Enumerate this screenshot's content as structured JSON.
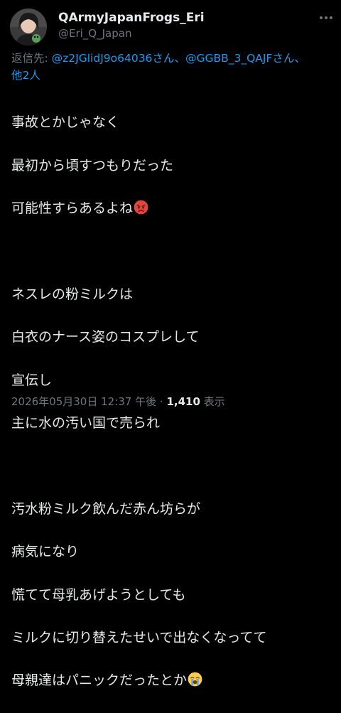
{
  "author": {
    "display_name": "QArmyJapanFrogs_Eri",
    "handle": "@Eri_Q_Japan"
  },
  "reply_to": {
    "prefix": "返信先: ",
    "mention_1": "@z2JGlidJ9o64036さん",
    "separator": "、",
    "mention_2": "@GGBB_3_QAJFさん",
    "separator_2": "、",
    "others": "他2人"
  },
  "body": {
    "line_1": "事故とかじゃなく",
    "line_2": "最初から頃すつもりだった",
    "line_3": "可能性すらあるよね",
    "line_4": "",
    "line_5": "ネスレの粉ミルクは",
    "line_6": "白衣のナース姿のコスプレして",
    "line_7": "宣伝し",
    "line_8": "主に水の汚い国で売られ",
    "line_9": "",
    "line_10": "汚水粉ミルク飲んだ赤ん坊らが",
    "line_11": "病気になり",
    "line_12": "慌てて母乳あげようとしても",
    "line_13": "ミルクに切り替えたせいで出なくなってて",
    "line_14": "母親達はパニックだったとか"
  },
  "emoji": {
    "angry": "angry-face-emoji",
    "crying": "loudly-crying-face-emoji"
  },
  "meta": {
    "timestamp": "2026年05月30日 12:37 午後",
    "dot": " · ",
    "views_count": "1,410",
    "views_label": " 表示"
  },
  "colors": {
    "background": "#000000",
    "text": "#e7e9ea",
    "secondary": "#71767b",
    "link": "#1d9bf0"
  }
}
